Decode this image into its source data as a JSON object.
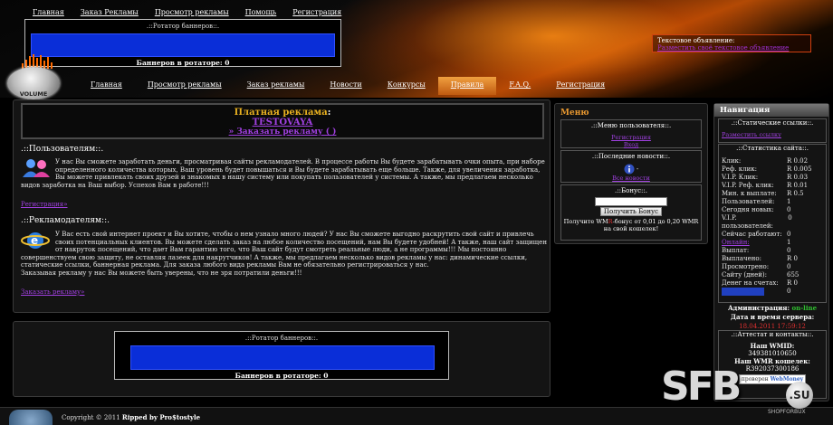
{
  "top_nav": [
    "Главная",
    "Заказ Рекламы",
    "Просмотр рекламы",
    "Помощь",
    "Регистрация"
  ],
  "top_rotator": {
    "title": ".::Ротатор баннеров::.",
    "count": "Баннеров в ротаторе: 0"
  },
  "text_ad": {
    "title": "Текстовое объявление:",
    "link": "Разместить своё текстовое объявление"
  },
  "volume_label": "VOLUME",
  "main_menu": [
    "Главная",
    "Просмотр рекламы",
    "Заказ рекламы",
    "Новости",
    "Конкурсы",
    "Правила",
    "F.A.Q.",
    "Регистрация"
  ],
  "main_menu_active": "Правила",
  "paid_ad": {
    "title": "Платная реклама",
    "name": "TESTOVAYA",
    "order_link": "» Заказать рекламу ( )"
  },
  "users": {
    "title": ".::Пользователям::.",
    "text": "У нас Вы сможете заработать деньги, просматривая сайты рекламодателей. В процессе работы Вы будете зарабатывать очки опыта, при наборе определенного количества которых, Ваш уровень будет повышаться и Вы будете зарабатывать еще больше. Также, для увеличения заработка, Вы можете привлекать своих друзей и знакомых в нашу систему или покупать пользователей у системы. А также, мы предлагаем несколько видов заработка на Ваш выбор. Успехов Вам в работе!!!",
    "link": "Регистрация»"
  },
  "advertisers": {
    "title": ".::Рекламодателям::.",
    "text": "У Вас есть свой интернет проект и Вы хотите, чтобы о нем узнало много людей? У нас Вы сможете выгодно раскрутить свой сайт и привлечь своих потенциальных клиентов. Вы можете сделать заказ на любое количество посещений, нам Вы будете удобней! А также, наш сайт защищен от накруток посещений, что дает Вам гарантию того, что Ваш сайт будут смотреть реальные люди, а не программы!!! Мы постоянно совершенствуем свою защиту, не оставляя лазеек для накрутчиков! А также, мы предлагаем несколько видов рекламы у нас: динамические ссылки, статические ссылки, баннерная реклама. Для заказа любого вида рекламы Вам не обязательно регистрироваться у нас.",
    "text2": "Заказывая рекламу у нас Вы можете быть уверены, что не зря потратили деньги!!!",
    "link": "Заказать рекламу»"
  },
  "bottom_rotator": {
    "title": ".::Ротатор баннеров::.",
    "count": "Баннеров в ротаторе: 0"
  },
  "menu_col": {
    "title": "Меню",
    "user_menu_title": ".::Меню пользователя::.",
    "register": "Регистрация",
    "login": "Вход",
    "news_title": ".::Последние новости::.",
    "news_dash": "-",
    "news_link": "Все новости",
    "bonus_title": ".::Бонус::.",
    "bonus_button": "Получить Бонус",
    "bonus_text_a": "Получите WM",
    "bonus_text_b": "-бонус от 0,01 до 0,20 WMR на свой кошелек!",
    "bonus_letter": "R"
  },
  "nav_col": {
    "title": "Навигация",
    "static_links_title": ".::Статические ссылки::.",
    "static_link": "Разместить ссылку",
    "stats_title": ".::Статистика сайта::.",
    "stats": [
      {
        "label": "Клик:",
        "value": "R 0.02"
      },
      {
        "label": "Реф. клик:",
        "value": "R 0.005"
      },
      {
        "label": "V.I.P. Клик:",
        "value": "R 0.03"
      },
      {
        "label": "V.I.P. Реф. клик:",
        "value": "R 0.01"
      },
      {
        "label": "Мин. к выплате:",
        "value": "R 0.5"
      },
      {
        "label": "Пользователей:",
        "value": "1"
      },
      {
        "label": "Сегодня новых:",
        "value": "0"
      },
      {
        "label": "V.I.P. пользователей:",
        "value": "0"
      },
      {
        "label": "Сейчас работают:",
        "value": "0"
      },
      {
        "label": "Онлайн:",
        "value": "1"
      },
      {
        "label": "Выплат:",
        "value": "0"
      },
      {
        "label": "Выплачено:",
        "value": "R 0"
      },
      {
        "label": "Просмотрено:",
        "value": "0"
      },
      {
        "label": "Сайту (дней):",
        "value": "655"
      },
      {
        "label": "Денег на счетах:",
        "value": "R 0"
      },
      {
        "label": "Все ведущие",
        "value": "0"
      }
    ],
    "admin_label": "Администрация:",
    "admin_status": "on-line",
    "datetime_label": "Дата и время сервера:",
    "datetime_value": "18.04.2011 17:59:12",
    "attest_title": ".::Аттестат и контакты::.",
    "wmid_label": "Наш WMID:",
    "wmid": "349381010650",
    "wallet_label": "Наш WMR кошелек:",
    "wallet": "R392037300186",
    "check_label": "проверен",
    "webmoney_label": "WebMoney"
  },
  "footer": {
    "copyright": "Copyright © 2011",
    "author": "Ripped by Pro$tostyle"
  },
  "watermark": {
    "main": "SFB",
    "domain": ".SU",
    "tag": "SHOPFORBUX"
  }
}
